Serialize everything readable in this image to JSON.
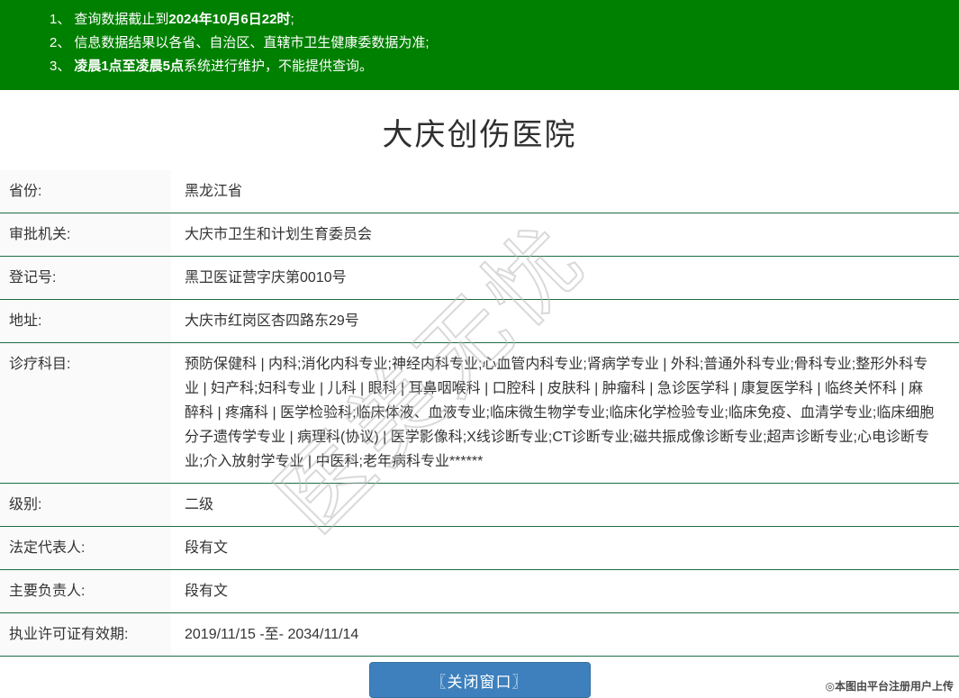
{
  "banner": {
    "items": [
      {
        "num": "1、",
        "pre": "查询数据截止到",
        "bold": "2024年10月6日22时",
        "post": ";"
      },
      {
        "num": "2、",
        "pre": "信息数据结果以各省、自治区、直辖市卫生健康委数据为准;",
        "bold": "",
        "post": ""
      },
      {
        "num": "3、",
        "pre": "",
        "bold": "凌晨1点至凌晨5点",
        "post": "系统进行维护，不能提供查询。"
      }
    ]
  },
  "page_title": "大庆创伤医院",
  "info_table": {
    "rows": [
      {
        "label": "省份:",
        "value": "黑龙江省"
      },
      {
        "label": "审批机关:",
        "value": "大庆市卫生和计划生育委员会"
      },
      {
        "label": "登记号:",
        "value": "黑卫医证营字庆第0010号"
      },
      {
        "label": "地址:",
        "value": "大庆市红岗区杏四路东29号"
      },
      {
        "label": "诊疗科目:",
        "value": "预防保健科 | 内科;消化内科专业;神经内科专业;心血管内科专业;肾病学专业 | 外科;普通外科专业;骨科专业;整形外科专业 | 妇产科;妇科专业 | 儿科 | 眼科 | 耳鼻咽喉科 | 口腔科 | 皮肤科 | 肿瘤科 | 急诊医学科 | 康复医学科 | 临终关怀科 | 麻醉科 | 疼痛科 | 医学检验科;临床体液、血液专业;临床微生物学专业;临床化学检验专业;临床免疫、血清学专业;临床细胞分子遗传学专业 | 病理科(协议) | 医学影像科;X线诊断专业;CT诊断专业;磁共振成像诊断专业;超声诊断专业;心电诊断专业;介入放射学专业 | 中医科;老年病科专业******"
      },
      {
        "label": "级别:",
        "value": "二级"
      },
      {
        "label": "法定代表人:",
        "value": "段有文"
      },
      {
        "label": "主要负责人:",
        "value": "段有文"
      },
      {
        "label": "执业许可证有效期:",
        "value": "2019/11/15 -至- 2034/11/14"
      }
    ]
  },
  "close_button_label": "〖关闭窗口〗",
  "watermark_text": "医美无忧",
  "footer_note": "◎本图由平台注册用户上传",
  "colors": {
    "banner_green": "#008000",
    "divider_green": "#1e6c45",
    "button_blue": "#3d80bd",
    "label_bg": "#fafafa"
  }
}
